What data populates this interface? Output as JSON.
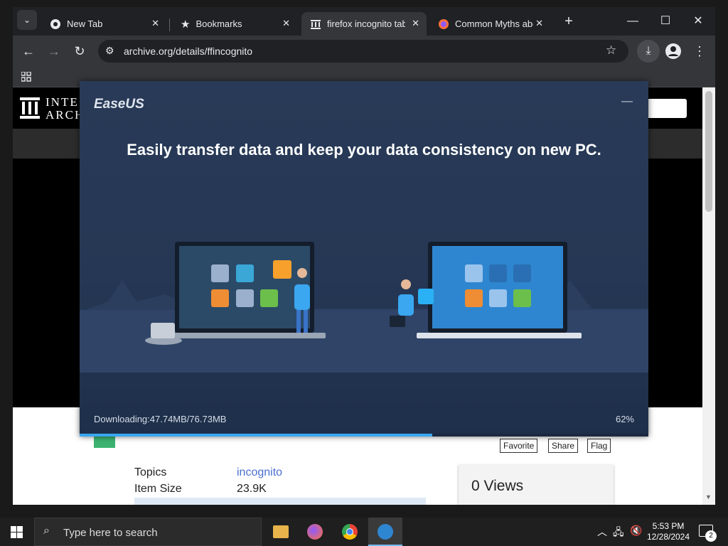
{
  "browser": {
    "tabs": [
      {
        "label": "New Tab",
        "icon": "chrome-icon"
      },
      {
        "label": "Bookmarks",
        "icon": "star-icon"
      },
      {
        "label": "firefox incognito tab",
        "icon": "archive-icon"
      },
      {
        "label": "Common Myths abo",
        "icon": "firefox-icon"
      }
    ],
    "url": "archive.org/details/ffincognito"
  },
  "page": {
    "logo_line1": "INTE",
    "logo_line2": "ARCH",
    "buttons": {
      "favorite": "Favorite",
      "share": "Share",
      "flag": "Flag"
    },
    "meta": [
      {
        "key": "Topics",
        "value": "incognito"
      },
      {
        "key": "Item Size",
        "value": "23.9K"
      }
    ],
    "views": "0 Views"
  },
  "installer": {
    "brand": "EaseUS",
    "headline": "Easily transfer data and keep your data consistency on new PC.",
    "download_status": "Downloading:47.74MB/76.73MB",
    "progress_text": "62%",
    "progress": 0.62,
    "colors": {
      "progress": "#3aa7f0",
      "bg": "#253754"
    }
  },
  "taskbar": {
    "search_placeholder": "Type here to search",
    "time": "5:53 PM",
    "date": "12/28/2024",
    "notif_count": "2"
  }
}
